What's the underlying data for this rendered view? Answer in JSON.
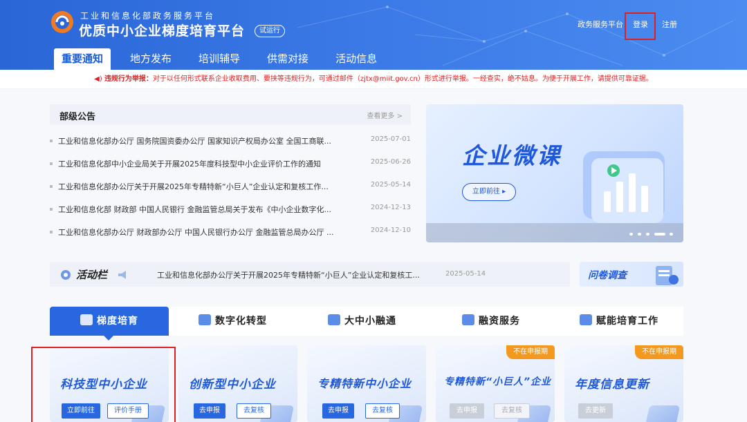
{
  "header": {
    "subtitle": "工业和信息化部政务服务平台",
    "title": "优质中小企业梯度培育平台",
    "badge": "试运行",
    "links": {
      "gov_service": "政务服务平台",
      "login": "登录",
      "register": "注册"
    },
    "nav": [
      "重要通知",
      "地方发布",
      "培训辅导",
      "供需对接",
      "活动信息"
    ]
  },
  "notice": {
    "prefix": "违规行为举报：",
    "text": "对于以任何形式联系企业收取费用、要挟等违规行为，可通过邮件（zjtx@miit.gov.cn）形式进行举报。一经查实，绝不姑息。为便于开展工作，请提供可靠证据。"
  },
  "announcements": {
    "title": "部级公告",
    "more": "查看更多 >",
    "items": [
      {
        "title": "工业和信息化部办公厅 国务院国资委办公厅 国家知识产权局办公室 全国工商联...",
        "date": "2025-07-01"
      },
      {
        "title": "工业和信息化部中小企业局关于开展2025年度科技型中小企业评价工作的通知",
        "date": "2025-06-26"
      },
      {
        "title": "工业和信息化部办公厅关于开展2025年专精特新“小巨人”企业认定和复核工作...",
        "date": "2025-05-14"
      },
      {
        "title": "工业和信息化部 财政部 中国人民银行 金融监管总局关于发布《中小企业数字化...",
        "date": "2024-12-13"
      },
      {
        "title": "工业和信息化部办公厅 财政部办公厅 中国人民银行办公厅 金融监管总局办公厅 ...",
        "date": "2024-12-10"
      }
    ]
  },
  "banner": {
    "title": "企业微课",
    "button": "立即前往 ▸"
  },
  "activity": {
    "title": "活动栏",
    "text": "工业和信息化部办公厅关于开展2025年专精特新“小巨人”企业认定和复核工...",
    "date": "2025-05-14"
  },
  "survey": {
    "title": "问卷调查"
  },
  "category_tabs": [
    "梯度培育",
    "数字化转型",
    "大中小融通",
    "融资服务",
    "赋能培育工作"
  ],
  "cards": [
    {
      "title": "科技型中小企业",
      "btn1": "立即前往",
      "btn2": "评价手册",
      "status": ""
    },
    {
      "title": "创新型中小企业",
      "btn1": "去申报",
      "btn2": "去复核",
      "status": ""
    },
    {
      "title": "专精特新中小企业",
      "btn1": "去申报",
      "btn2": "去复核",
      "status": ""
    },
    {
      "title": "专精特新“小巨人”企业",
      "btn1": "去申报",
      "btn2": "去复核",
      "status": "不在申报期"
    },
    {
      "title": "年度信息更新",
      "btn1": "去更新",
      "btn2": "",
      "status": "不在申报期"
    }
  ],
  "colors": {
    "brand_blue": "#2867e0",
    "alert_red": "#e02020",
    "status_orange": "#f39a1e"
  }
}
